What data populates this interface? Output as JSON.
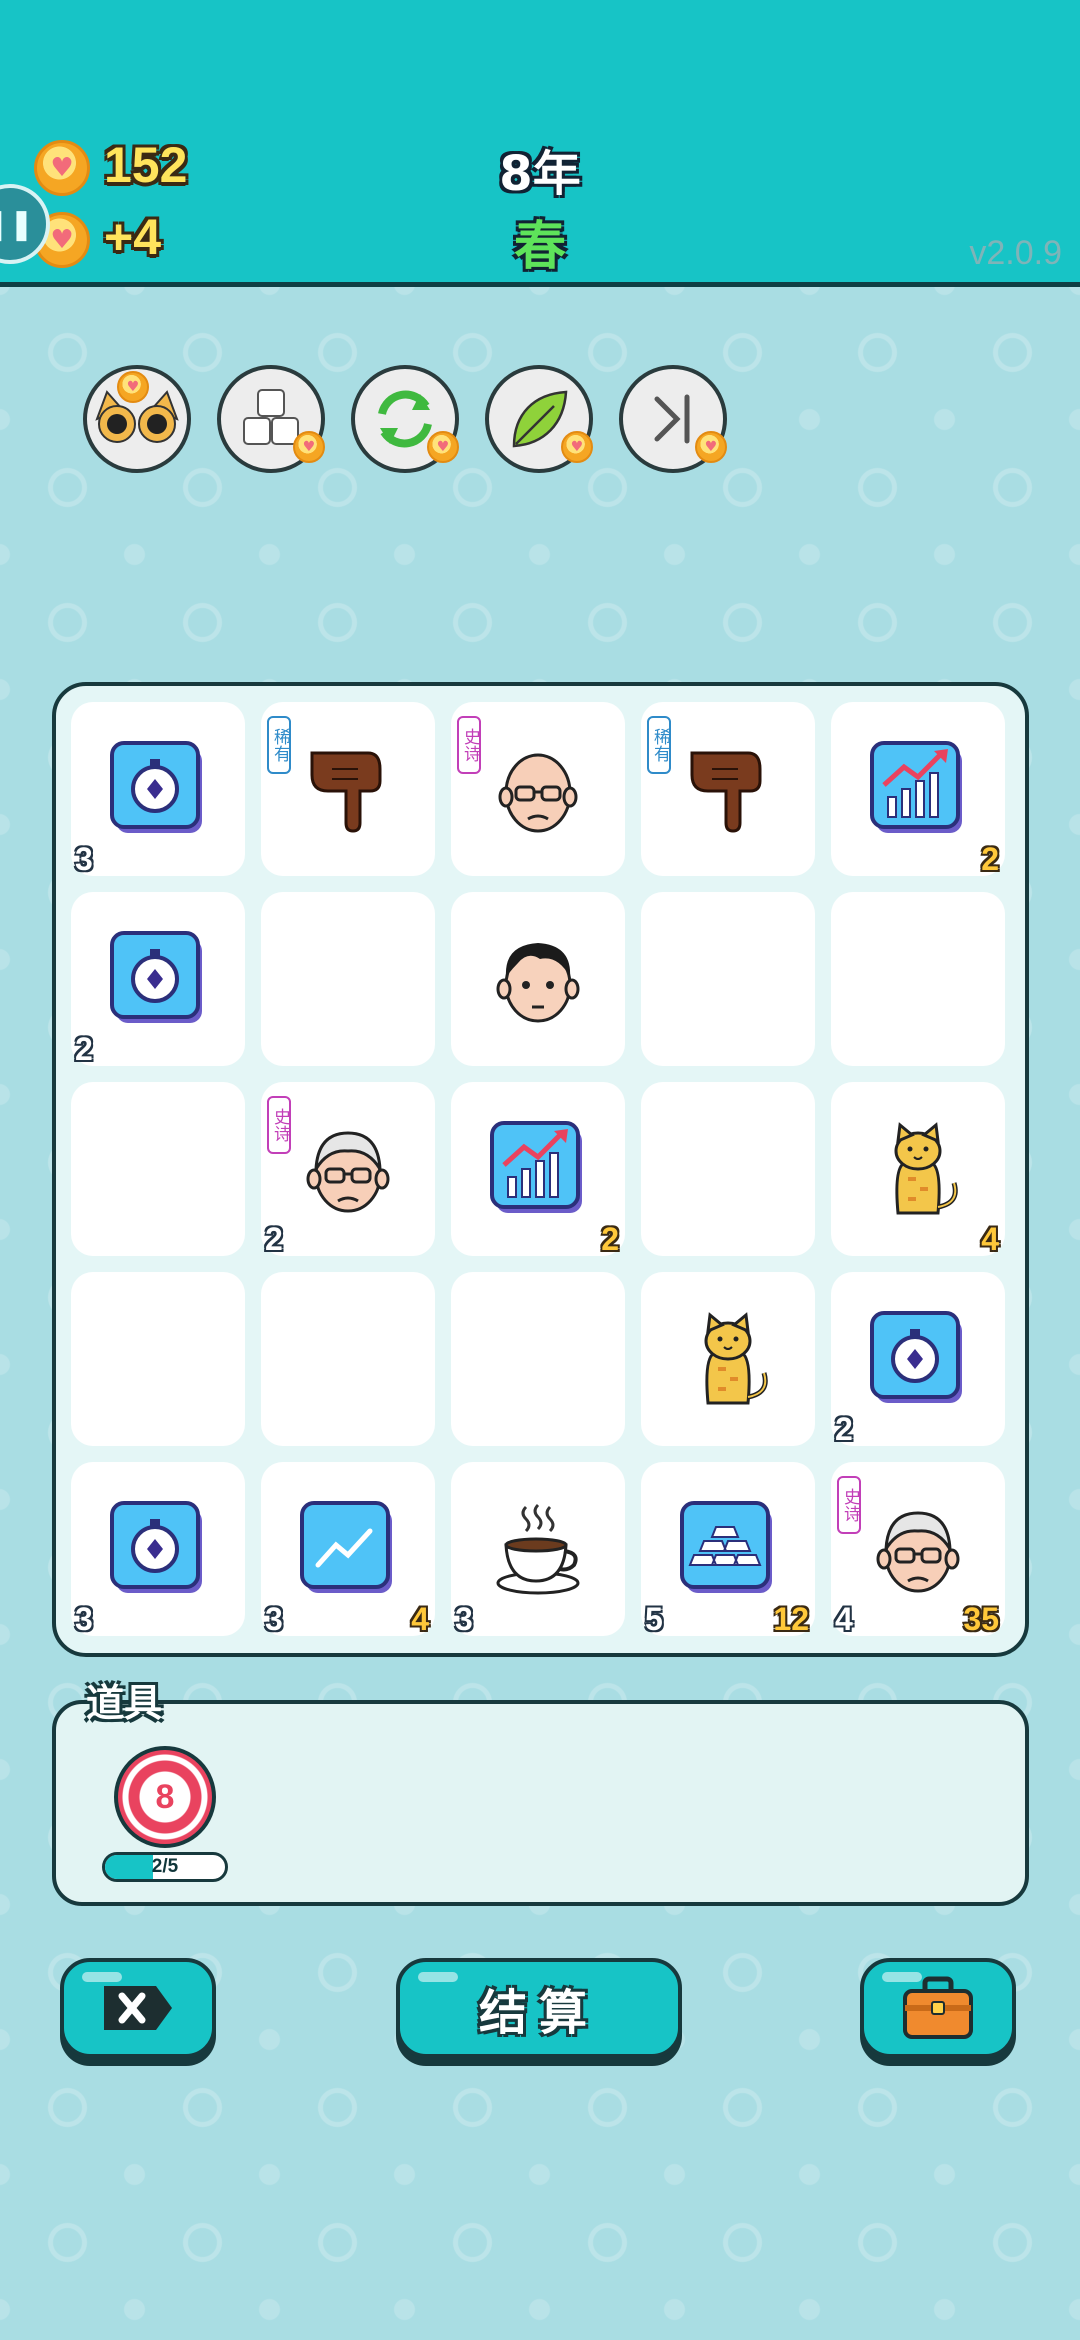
{
  "header": {
    "coins": "152",
    "income": "+4",
    "year": "8年",
    "season": "春",
    "version": "v2.0.9",
    "side_tab": "❚❚"
  },
  "tools": [
    {
      "name": "cat-eyes-tool"
    },
    {
      "name": "cubes-tool"
    },
    {
      "name": "refresh-tool"
    },
    {
      "name": "leaf-tool"
    },
    {
      "name": "skip-tool"
    }
  ],
  "board": [
    [
      {
        "icon": "stopwatch-card",
        "left": "3"
      },
      {
        "icon": "pointing-hand",
        "tag": "稀有",
        "tag_type": "rare"
      },
      {
        "icon": "bald-old-man",
        "tag": "史诗",
        "tag_type": "epic"
      },
      {
        "icon": "pointing-hand",
        "tag": "稀有",
        "tag_type": "rare"
      },
      {
        "icon": "chart-card",
        "right": "2"
      }
    ],
    [
      {
        "icon": "stopwatch-card",
        "left": "2"
      },
      {
        "icon": ""
      },
      {
        "icon": "young-man"
      },
      {
        "icon": ""
      },
      {
        "icon": ""
      }
    ],
    [
      {
        "icon": ""
      },
      {
        "icon": "grandpa",
        "tag": "史诗",
        "tag_type": "epic",
        "left": "2"
      },
      {
        "icon": "chart-card",
        "right": "2"
      },
      {
        "icon": ""
      },
      {
        "icon": "cat",
        "right": "4"
      }
    ],
    [
      {
        "icon": ""
      },
      {
        "icon": ""
      },
      {
        "icon": ""
      },
      {
        "icon": "cat"
      },
      {
        "icon": "stopwatch-card",
        "left": "2"
      }
    ],
    [
      {
        "icon": "stopwatch-card",
        "left": "3"
      },
      {
        "icon": "trend-card",
        "left": "3",
        "right": "4"
      },
      {
        "icon": "coffee-cup",
        "left": "3"
      },
      {
        "icon": "gold-bars-card",
        "left": "5",
        "right": "12"
      },
      {
        "icon": "grandpa",
        "tag": "史诗",
        "tag_type": "epic",
        "left": "4",
        "right": "35"
      }
    ]
  ],
  "items": {
    "label": "道具",
    "target_value": "8",
    "progress_text": "2/5",
    "progress_fraction": 0.4
  },
  "buttons": {
    "settle": "结算"
  },
  "colors": {
    "header": "#17c4c6",
    "coin": "#ffe45c",
    "season": "#5ee35a",
    "gain": "#ffc83a"
  }
}
